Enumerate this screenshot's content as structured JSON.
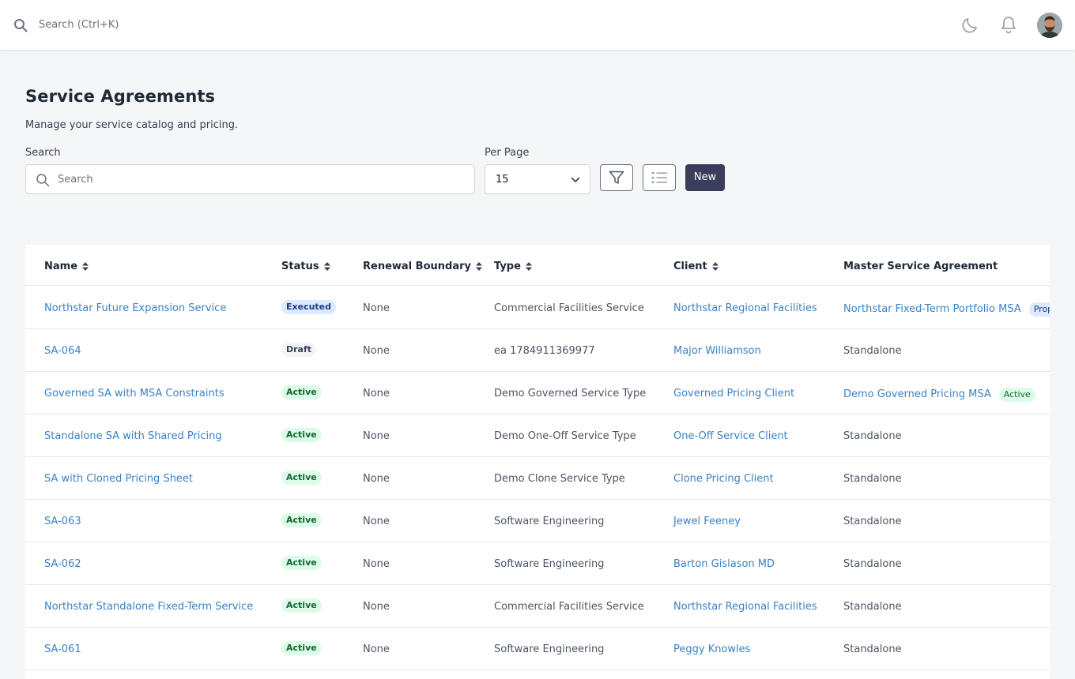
{
  "topbar": {
    "search_placeholder": "Search (Ctrl+K)",
    "icons": [
      "search-icon",
      "moon-icon",
      "bell-icon",
      "avatar"
    ]
  },
  "header": {
    "title": "Service Agreements",
    "subtitle": "Manage your service catalog and pricing."
  },
  "filters": {
    "search_label": "Search",
    "search_placeholder": "Search",
    "per_page_label": "Per Page",
    "per_page_value": "15",
    "new_button": "New"
  },
  "table": {
    "columns": [
      "Name",
      "Status",
      "Renewal Boundary",
      "Type",
      "Client",
      "Master Service Agreement"
    ],
    "rows": [
      {
        "name": "Northstar Future Expansion Service",
        "status": "Executed",
        "renewal": "None",
        "type": "Commercial Facilities Service",
        "client": "Northstar Regional Facilities",
        "msa": "Northstar Fixed-Term Portfolio MSA",
        "msa_tag": "Proposed"
      },
      {
        "name": "SA-064",
        "status": "Draft",
        "renewal": "None",
        "type": "ea 1784911369977",
        "client": "Major Williamson",
        "msa": "Standalone",
        "msa_tag": ""
      },
      {
        "name": "Governed SA with MSA Constraints",
        "status": "Active",
        "renewal": "None",
        "type": "Demo Governed Service Type",
        "client": "Governed Pricing Client",
        "msa": "Demo Governed Pricing MSA",
        "msa_tag": "Active"
      },
      {
        "name": "Standalone SA with Shared Pricing",
        "status": "Active",
        "renewal": "None",
        "type": "Demo One-Off Service Type",
        "client": "One-Off Service Client",
        "msa": "Standalone",
        "msa_tag": ""
      },
      {
        "name": "SA with Cloned Pricing Sheet",
        "status": "Active",
        "renewal": "None",
        "type": "Demo Clone Service Type",
        "client": "Clone Pricing Client",
        "msa": "Standalone",
        "msa_tag": ""
      },
      {
        "name": "SA-063",
        "status": "Active",
        "renewal": "None",
        "type": "Software Engineering",
        "client": "Jewel Feeney",
        "msa": "Standalone",
        "msa_tag": ""
      },
      {
        "name": "SA-062",
        "status": "Active",
        "renewal": "None",
        "type": "Software Engineering",
        "client": "Barton Gislason MD",
        "msa": "Standalone",
        "msa_tag": ""
      },
      {
        "name": "Northstar Standalone Fixed-Term Service",
        "status": "Active",
        "renewal": "None",
        "type": "Commercial Facilities Service",
        "client": "Northstar Regional Facilities",
        "msa": "Standalone",
        "msa_tag": ""
      },
      {
        "name": "SA-061",
        "status": "Active",
        "renewal": "None",
        "type": "Software Engineering",
        "client": "Peggy Knowles",
        "msa": "Standalone",
        "msa_tag": ""
      }
    ]
  }
}
